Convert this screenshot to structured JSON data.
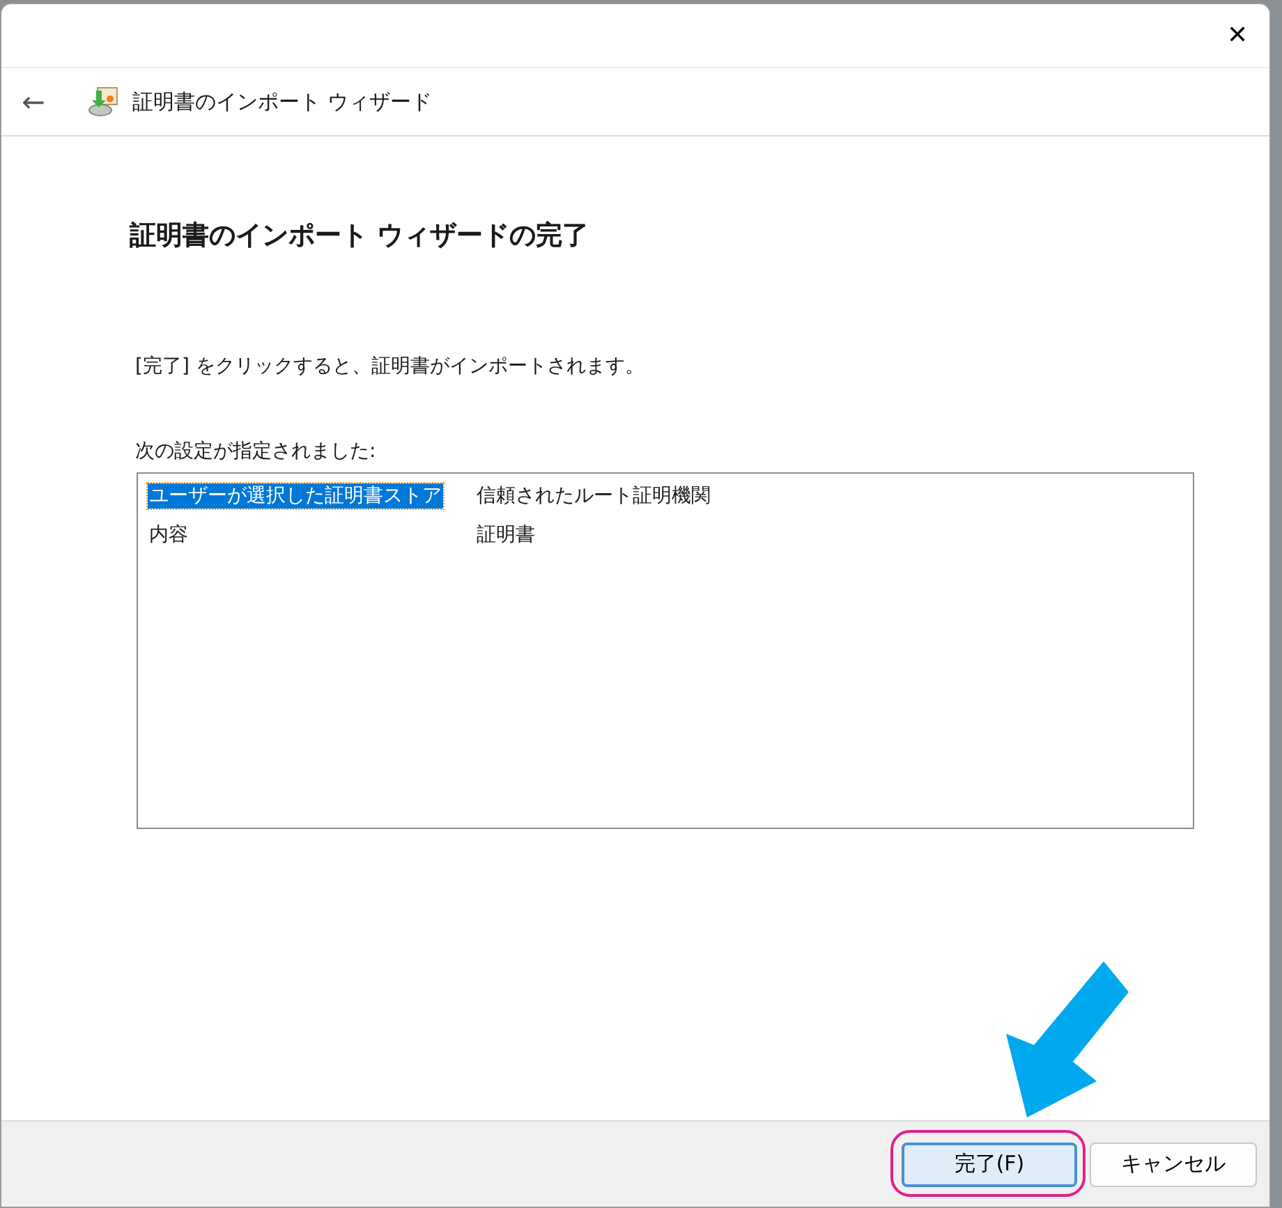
{
  "window": {
    "close": "✕",
    "back": "←",
    "title": "証明書のインポート ウィザード"
  },
  "heading": "証明書のインポート ウィザードの完了",
  "instruction": "[完了] をクリックすると、証明書がインポートされます。",
  "settings_label": "次の設定が指定されました:",
  "settings": [
    {
      "name": "ユーザーが選択した証明書ストア",
      "value": "信頼されたルート証明機関",
      "selected": true
    },
    {
      "name": "内容",
      "value": "証明書",
      "selected": false
    }
  ],
  "buttons": [
    {
      "label": "完了(F)",
      "default": true
    },
    {
      "label": "キャンセル",
      "default": false
    }
  ]
}
